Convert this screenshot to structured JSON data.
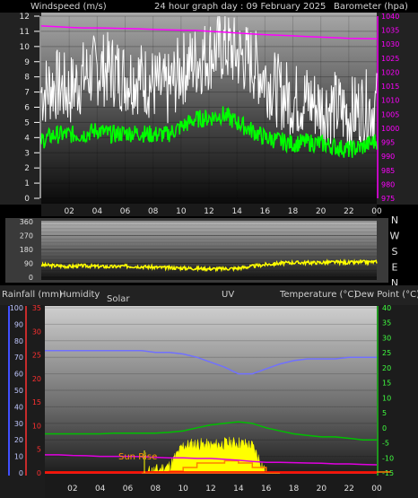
{
  "header": {
    "left": "Windspeed (m/s)",
    "center": "24 hour graph day : 09 February 2025",
    "right": "Barometer (hpa)"
  },
  "labels_row": {
    "rainfall": "Rainfall (mm)",
    "humidity": "Humidity",
    "solar": "Solar",
    "uv": "UV",
    "temperature": "Temperature (°C)",
    "dewpoint": "Dew Point (°C)"
  },
  "annotations": {
    "sun_rise": "Sun Rise"
  },
  "colors": {
    "wind_gust": "#ffffff",
    "wind_avg": "#00ff00",
    "barometer": "#ff00ff",
    "direction": "#ffff00",
    "humidity": "#7070ff",
    "temperature": "#00c000",
    "dewpoint": "#e000e0",
    "solar": "#ffff00",
    "uv": "#ff8000",
    "rain": "#ff0000"
  },
  "chart_data": [
    {
      "type": "line",
      "name": "wind",
      "x_ticks": [
        "02",
        "04",
        "06",
        "08",
        "10",
        "12",
        "14",
        "16",
        "18",
        "20",
        "22",
        "00"
      ],
      "ylim_left": [
        0,
        12
      ],
      "y_ticks_left": [
        "0",
        "1",
        "2",
        "3",
        "4",
        "5",
        "6",
        "7",
        "8",
        "9",
        "10",
        "11",
        "12"
      ],
      "ylim_right": [
        975,
        1040
      ],
      "y_ticks_right": [
        "975",
        "980",
        "985",
        "990",
        "995",
        "1000",
        "1005",
        "1010",
        "1015",
        "1020",
        "1025",
        "1030",
        "1035",
        "1040"
      ],
      "x_hours": [
        0,
        1,
        2,
        3,
        4,
        5,
        6,
        7,
        8,
        9,
        10,
        11,
        12,
        13,
        14,
        15,
        16,
        17,
        18,
        19,
        20,
        21,
        22,
        23,
        24
      ],
      "series": [
        {
          "key": "gust",
          "values": [
            7,
            7.5,
            7,
            8,
            8.5,
            8.5,
            8,
            8,
            7.5,
            7,
            8.5,
            9,
            9.5,
            10,
            9.5,
            9,
            8,
            7,
            6.5,
            6.5,
            6,
            6,
            5.5,
            6,
            6
          ]
        },
        {
          "key": "avg",
          "values": [
            3.8,
            4.2,
            4.2,
            4.2,
            4.5,
            4.2,
            4.3,
            4.3,
            4.2,
            4.2,
            4.7,
            5.2,
            5.3,
            5.5,
            5.0,
            4.5,
            4.0,
            3.8,
            3.6,
            3.7,
            3.6,
            3.4,
            3.2,
            3.4,
            3.8
          ]
        },
        {
          "key": "baro",
          "values": [
            1036.5,
            1036.3,
            1036.0,
            1035.8,
            1035.8,
            1035.7,
            1035.6,
            1035.5,
            1035.3,
            1035.1,
            1035.0,
            1034.9,
            1034.6,
            1034.3,
            1034.0,
            1033.7,
            1033.4,
            1033.2,
            1033.0,
            1032.7,
            1032.5,
            1032.3,
            1032.1,
            1032.0,
            1031.9
          ]
        }
      ]
    },
    {
      "type": "line",
      "name": "direction",
      "ylim": [
        0,
        360
      ],
      "y_ticks": [
        "0",
        "90",
        "180",
        "270",
        "360"
      ],
      "compass": [
        "N",
        "W",
        "S",
        "E",
        "N"
      ],
      "x_hours": [
        0,
        1,
        2,
        3,
        4,
        5,
        6,
        7,
        8,
        9,
        10,
        11,
        12,
        13,
        14,
        15,
        16,
        17,
        18,
        19,
        20,
        21,
        22,
        23,
        24
      ],
      "values": [
        80,
        75,
        70,
        75,
        70,
        68,
        72,
        70,
        65,
        62,
        60,
        58,
        55,
        55,
        58,
        70,
        82,
        90,
        95,
        95,
        95,
        98,
        95,
        98,
        100
      ]
    },
    {
      "type": "line",
      "name": "climate",
      "ylim_rain": [
        0,
        35
      ],
      "y_ticks_rain": [
        "0",
        "5",
        "10",
        "15",
        "20",
        "25",
        "30",
        "35"
      ],
      "ylim_humidity": [
        0,
        100
      ],
      "y_ticks_humidity": [
        "0",
        "10",
        "20",
        "30",
        "40",
        "50",
        "60",
        "70",
        "80",
        "90",
        "100"
      ],
      "ylim_temp": [
        -15,
        40
      ],
      "y_ticks_temp": [
        "-15",
        "-10",
        "-5",
        "0",
        "5",
        "10",
        "15",
        "20",
        "25",
        "30",
        "35",
        "40"
      ],
      "x_hours": [
        0,
        1,
        2,
        3,
        4,
        5,
        6,
        7,
        8,
        9,
        10,
        11,
        12,
        13,
        14,
        15,
        16,
        17,
        18,
        19,
        20,
        21,
        22,
        23,
        24
      ],
      "series": [
        {
          "key": "humidity",
          "values": [
            74,
            74,
            74,
            74,
            74,
            74,
            74,
            74,
            73,
            73,
            72,
            70,
            67,
            64,
            60,
            60,
            63,
            66,
            68,
            69,
            69,
            69,
            70,
            70,
            70
          ]
        },
        {
          "key": "temperature",
          "values": [
            -2,
            -2,
            -2,
            -2,
            -2,
            -1.8,
            -1.8,
            -1.8,
            -1.8,
            -1.5,
            -1,
            0,
            1,
            1.5,
            2,
            1.5,
            0,
            -1,
            -2,
            -2.5,
            -3,
            -3,
            -3.5,
            -4,
            -4
          ]
        },
        {
          "key": "dewpoint",
          "values": [
            -9,
            -9,
            -9.2,
            -9.3,
            -9.5,
            -9.5,
            -9.5,
            -9.6,
            -9.8,
            -10,
            -10,
            -10.2,
            -10.2,
            -10.5,
            -10.8,
            -11.2,
            -11.5,
            -11.5,
            -11.6,
            -11.7,
            -11.8,
            -12,
            -12,
            -12.2,
            -12.3
          ]
        },
        {
          "key": "solar",
          "values": [
            0,
            0,
            0,
            0,
            0,
            0,
            0,
            0.1,
            0.5,
            1.5,
            6,
            6.5,
            6,
            6.5,
            6.7,
            6,
            0,
            0,
            0,
            0,
            0,
            0,
            0,
            0,
            0
          ]
        },
        {
          "key": "uv",
          "values": [
            0,
            0,
            0,
            0,
            0,
            0,
            0,
            0,
            0,
            0.2,
            1,
            2,
            2,
            2.5,
            2,
            1,
            0,
            0,
            0,
            0,
            0,
            0,
            0,
            0,
            0
          ]
        },
        {
          "key": "rain",
          "values": [
            0,
            0,
            0,
            0,
            0,
            0,
            0,
            0,
            0,
            0,
            0,
            0,
            0,
            0,
            0,
            0,
            0,
            0,
            0,
            0,
            0,
            0,
            0,
            0,
            0
          ]
        }
      ]
    }
  ]
}
